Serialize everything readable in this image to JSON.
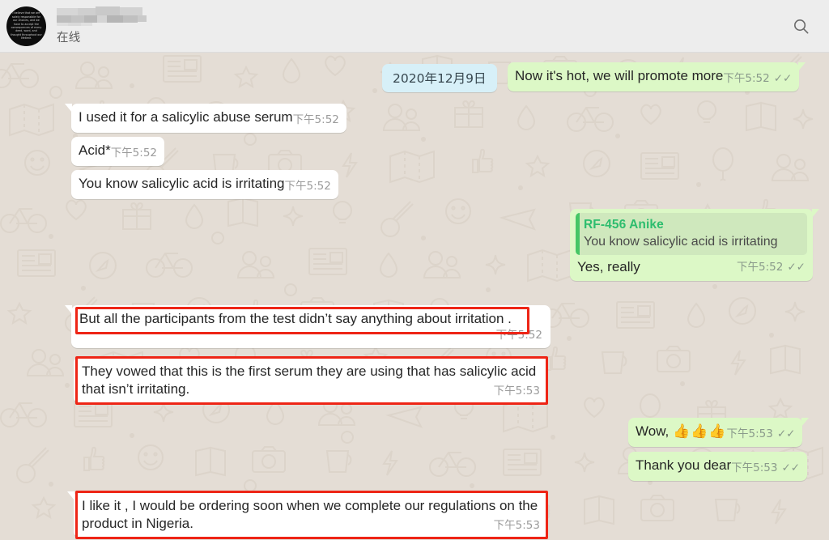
{
  "header": {
    "avatar_name": "avatar",
    "avatar_micro_text": "I believe that we are solely responsible for our choices, and we have to accept the consequences of every deed, word, and thought throughout our lifetime.",
    "contact_name_redacted": "",
    "status": "在线",
    "search_icon": "search-icon"
  },
  "chat": {
    "date_divider": "2020年12月9日",
    "messages": [
      {
        "id": "m1",
        "direction": "outgoing",
        "text": "Now it's hot, we will promote more",
        "time": "下午5:52",
        "ticks": "✓✓",
        "highlighted": false
      },
      {
        "id": "m2",
        "direction": "incoming",
        "text": "I used it for a salicylic abuse serum",
        "time": "下午5:52",
        "ticks": "",
        "highlighted": false
      },
      {
        "id": "m3",
        "direction": "incoming",
        "text": "Acid*",
        "time": "下午5:52",
        "ticks": "",
        "highlighted": false
      },
      {
        "id": "m4",
        "direction": "incoming",
        "text": "You know salicylic acid is irritating",
        "time": "下午5:52",
        "ticks": "",
        "highlighted": false
      },
      {
        "id": "m5",
        "direction": "outgoing",
        "quote_author": "RF-456 Anike",
        "quote_text": "You know salicylic acid is irritating",
        "text": "Yes, really",
        "time": "下午5:52",
        "ticks": "✓✓",
        "highlighted": false
      },
      {
        "id": "m6",
        "direction": "incoming",
        "text": "But all the participants from the test didn’t say anything about irritation .",
        "time": "下午5:52",
        "ticks": "",
        "highlighted": true
      },
      {
        "id": "m7",
        "direction": "incoming",
        "text": "They vowed that this is the first serum they are using that has salicylic acid that isn’t irritating.",
        "time": "下午5:53",
        "ticks": "",
        "highlighted": true
      },
      {
        "id": "m8",
        "direction": "outgoing",
        "text": "Wow, ",
        "emoji": "👍👍👍",
        "time": "下午5:53",
        "ticks": "✓✓",
        "highlighted": false
      },
      {
        "id": "m9",
        "direction": "outgoing",
        "text": "Thank you dear",
        "time": "下午5:53",
        "ticks": "✓✓",
        "highlighted": false
      },
      {
        "id": "m10",
        "direction": "incoming",
        "text": "I like it , I would be ordering soon when we complete our regulations on the product in Nigeria.",
        "time": "下午5:53",
        "ticks": "",
        "highlighted": true
      }
    ]
  },
  "colors": {
    "header_bg": "#ededed",
    "chat_bg": "#e4ddd5",
    "incoming_bubble": "#ffffff",
    "outgoing_bubble": "#dcf8c6",
    "date_chip": "#d7f0f8",
    "quote_bar": "#45c665",
    "quote_author": "#2dbd6e",
    "annotation": "#ee2516",
    "meta_text": "#8a9a8b"
  }
}
